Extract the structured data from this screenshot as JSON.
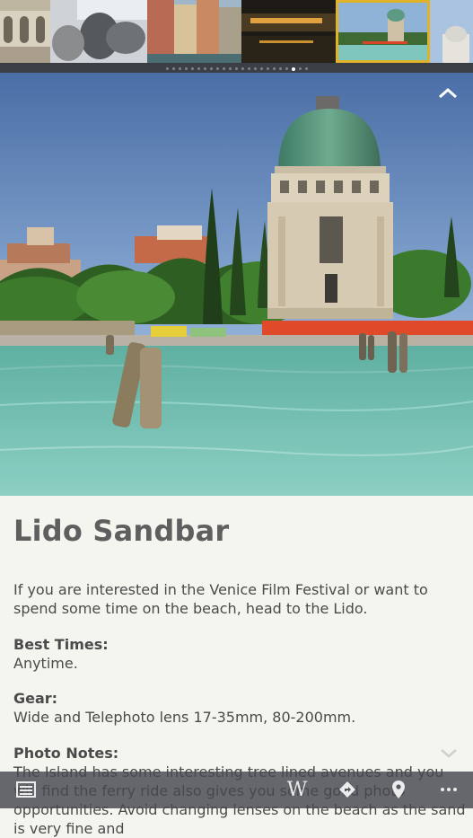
{
  "gallery": {
    "thumbnails": [
      "palace-arches",
      "lion-statue",
      "canal-houses",
      "night-canal",
      "lido-sandbar",
      "church-dome"
    ],
    "selected_index": 4,
    "page_count": 23,
    "active_page": 20
  },
  "hero": {
    "image": "lido-sandbar-domed-building"
  },
  "place": {
    "title": "Lido Sandbar",
    "intro": "If you are interested in the Venice Film Festival or want to spend some time on the beach, head to the Lido.",
    "best_times_label": "Best Times:",
    "best_times_value": "Anytime.",
    "gear_label": "Gear:",
    "gear_value": "Wide and Telephoto lens 17-35mm, 80-200mm.",
    "photo_notes_label": "Photo Notes:",
    "photo_notes_value": "The Island has some interesting tree lined avenues and you will find the ferry ride also gives you some good photo opportunities. Avoid changing lenses on the beach as the sand is very fine and"
  },
  "toolbar": {
    "icons": [
      "list-icon",
      "wikipedia-icon",
      "directions-icon",
      "map-pin-icon",
      "more-icon"
    ],
    "wiki_glyph": "W"
  },
  "colors": {
    "selected_outline": "#e0b22a",
    "title": "#5f5f5f"
  }
}
